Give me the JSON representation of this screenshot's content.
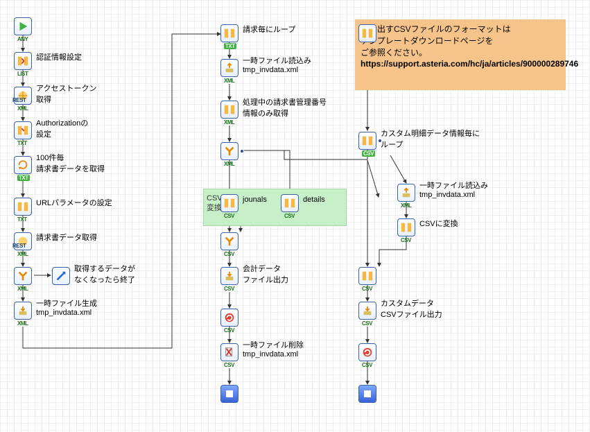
{
  "comment": {
    "line1": "書き出すCSVファイルのフォーマットは",
    "line2": "テンプレートダウンロードページを",
    "line3": "ご参照ください。",
    "url": "https://support.asteria.com/hc/ja/articles/900000289746"
  },
  "group_green": {
    "label1": "CSVに",
    "label2": "変換"
  },
  "types": {
    "any": "ANY",
    "list": "LIST",
    "xml": "XML",
    "txt": "TXT",
    "csv": "CSV",
    "rest": "REST"
  },
  "nodes": {
    "start": {
      "label": "",
      "type": "any"
    },
    "auth_set": {
      "label": "認証情報設定",
      "type": "list"
    },
    "token": {
      "label1": "アクセストークン",
      "label2": "取得",
      "type": "xml",
      "type2": "rest"
    },
    "authz": {
      "label1": "Authorizationの",
      "label2": "設定",
      "type": "txt"
    },
    "get100": {
      "label1": "100件毎",
      "label2": "請求書データを取得",
      "type": "txt_gr"
    },
    "urlparam": {
      "label": "URLパラメータの設定",
      "type": "txt"
    },
    "getdata": {
      "label": "請求書データ取得",
      "type": "xml",
      "type2": "rest"
    },
    "branch_end": {
      "label1": "取得するデータが",
      "label2": "なくなったら終了",
      "type": "xml"
    },
    "tmpgen": {
      "label1": "一時ファイル生成",
      "label2": "tmp_invdata.xml",
      "type": "xml"
    },
    "loop_inv": {
      "label": "請求毎にループ",
      "type": "txt_gr"
    },
    "tmpread": {
      "label1": "一時ファイル読込み",
      "label2": "tmp_invdata.xml",
      "type": "xml"
    },
    "filter": {
      "label1": "処理中の請求書管理番号",
      "label2": "情報のみ取得",
      "type": "xml"
    },
    "split": {
      "type": "xml"
    },
    "journals": {
      "label": "jounals",
      "type": "csv"
    },
    "details": {
      "label": "details",
      "type": "csv"
    },
    "merge": {
      "type": "csv"
    },
    "out1": {
      "label1": "会計データ",
      "label2": "ファイル出力",
      "type": "csv"
    },
    "conv1": {
      "type": "csv"
    },
    "tmpdel": {
      "label1": "一時ファイル削除",
      "label2": "tmp_invdata.xml",
      "type": "csv"
    },
    "end1": {},
    "loop_cust": {
      "label1": "カスタム明細データ情報毎に",
      "label2": "ループ",
      "type": "csv_gr"
    },
    "tmpread2": {
      "label1": "一時ファイル読込み",
      "label2": "tmp_invdata.xml",
      "type": "xml"
    },
    "csv_conv2": {
      "label": "CSVに変換",
      "type": "csv"
    },
    "proc2": {
      "type": "csv"
    },
    "out2": {
      "label1": "カスタムデータ",
      "label2": "CSVファイル出力",
      "type": "csv"
    },
    "conv2": {
      "type": "csv"
    },
    "end2": {}
  }
}
